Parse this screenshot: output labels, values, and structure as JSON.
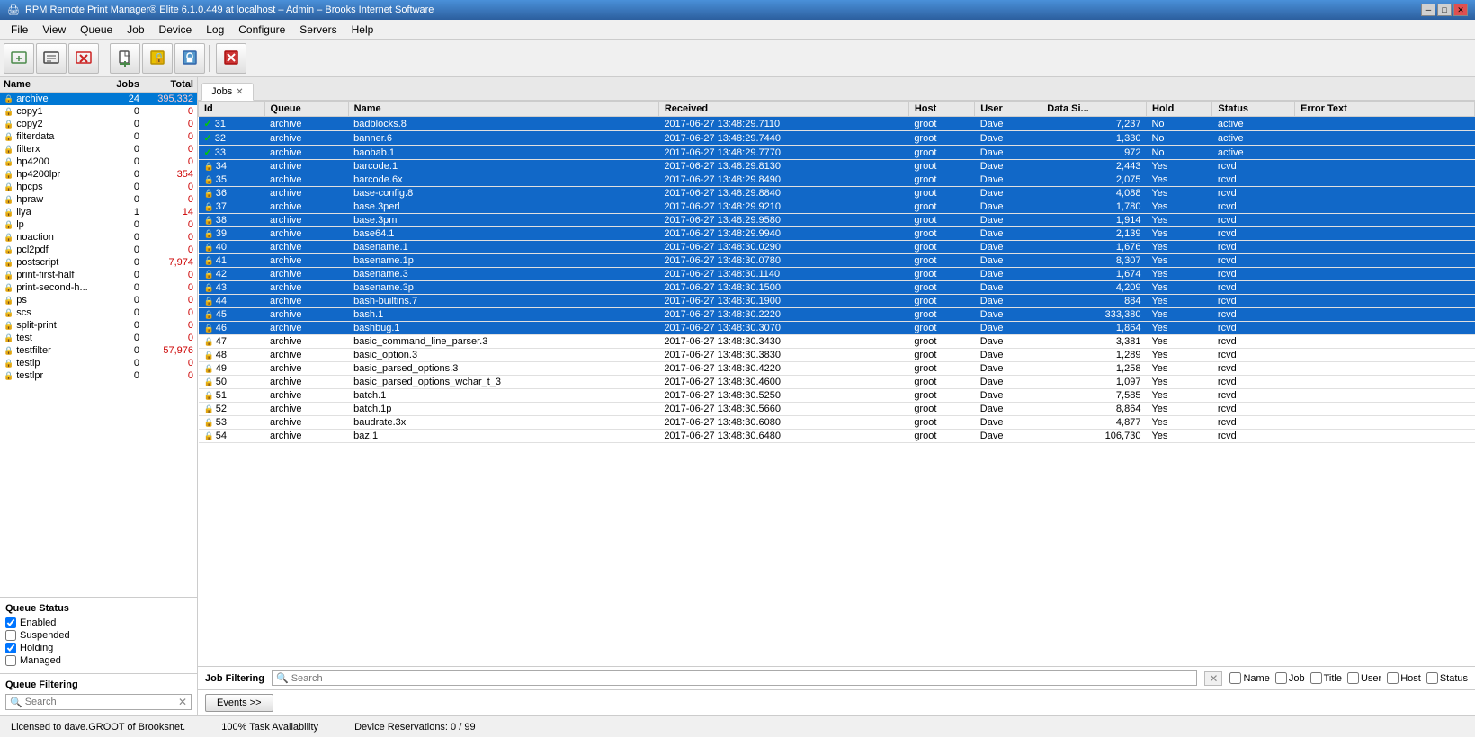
{
  "titlebar": {
    "title": "RPM Remote Print Manager® Elite  6.1.0.449  at localhost – Admin – Brooks Internet Software",
    "icon": "🖨"
  },
  "menubar": {
    "items": [
      "File",
      "View",
      "Queue",
      "Job",
      "Device",
      "Log",
      "Configure",
      "Servers",
      "Help"
    ]
  },
  "toolbar": {
    "buttons": [
      {
        "name": "add-queue",
        "icon": "➕",
        "label": "Add Queue"
      },
      {
        "name": "edit-queue",
        "icon": "✏",
        "label": "Edit Queue"
      },
      {
        "name": "delete-queue",
        "icon": "🗑",
        "label": "Delete Queue"
      },
      {
        "name": "sep1",
        "type": "separator"
      },
      {
        "name": "new-job",
        "icon": "📄",
        "label": "New Job"
      },
      {
        "name": "hold-job",
        "icon": "🔒",
        "label": "Hold Job"
      },
      {
        "name": "lock-queue",
        "icon": "🔐",
        "label": "Lock Queue"
      },
      {
        "name": "sep2",
        "type": "separator"
      },
      {
        "name": "delete-job",
        "icon": "❌",
        "label": "Delete Job"
      }
    ]
  },
  "left_panel": {
    "column_headers": [
      "Name",
      "Jobs",
      "Total"
    ],
    "queues": [
      {
        "name": "archive",
        "jobs": 24,
        "total": "395,332",
        "icon": "lock",
        "selected": true
      },
      {
        "name": "copy1",
        "jobs": 0,
        "total": "0",
        "icon": "lock"
      },
      {
        "name": "copy2",
        "jobs": 0,
        "total": "0",
        "icon": "lock"
      },
      {
        "name": "filterdata",
        "jobs": 0,
        "total": "0",
        "icon": "lock"
      },
      {
        "name": "filterx",
        "jobs": 0,
        "total": "0",
        "icon": "lock"
      },
      {
        "name": "hp4200",
        "jobs": 0,
        "total": "0",
        "icon": "lock"
      },
      {
        "name": "hp4200lpr",
        "jobs": 0,
        "total": "354",
        "icon": "lock"
      },
      {
        "name": "hpcps",
        "jobs": 0,
        "total": "0",
        "icon": "lock"
      },
      {
        "name": "hpraw",
        "jobs": 0,
        "total": "0",
        "icon": "lock"
      },
      {
        "name": "ilya",
        "jobs": 1,
        "total": "14",
        "icon": "lock"
      },
      {
        "name": "lp",
        "jobs": 0,
        "total": "0",
        "icon": "lock"
      },
      {
        "name": "noaction",
        "jobs": 0,
        "total": "0",
        "icon": "lock"
      },
      {
        "name": "pcl2pdf",
        "jobs": 0,
        "total": "0",
        "icon": "lock"
      },
      {
        "name": "postscript",
        "jobs": 0,
        "total": "7,974",
        "icon": "lock"
      },
      {
        "name": "print-first-half",
        "jobs": 0,
        "total": "0",
        "icon": "lock"
      },
      {
        "name": "print-second-h...",
        "jobs": 0,
        "total": "0",
        "icon": "lock"
      },
      {
        "name": "ps",
        "jobs": 0,
        "total": "0",
        "icon": "lock"
      },
      {
        "name": "scs",
        "jobs": 0,
        "total": "0",
        "icon": "lock"
      },
      {
        "name": "split-print",
        "jobs": 0,
        "total": "0",
        "icon": "lock"
      },
      {
        "name": "test",
        "jobs": 0,
        "total": "0",
        "icon": "lock"
      },
      {
        "name": "testfilter",
        "jobs": 0,
        "total": "57,976",
        "icon": "lock"
      },
      {
        "name": "testip",
        "jobs": 0,
        "total": "0",
        "icon": "lock"
      },
      {
        "name": "testlpr",
        "jobs": 0,
        "total": "0",
        "icon": "lock"
      }
    ],
    "queue_status": {
      "title": "Queue Status",
      "items": [
        {
          "label": "Enabled",
          "checked": true
        },
        {
          "label": "Suspended",
          "checked": false
        },
        {
          "label": "Holding",
          "checked": true
        },
        {
          "label": "Managed",
          "checked": false
        }
      ]
    },
    "queue_filtering": {
      "title": "Queue Filtering",
      "search_placeholder": "Search"
    }
  },
  "main_panel": {
    "tab": {
      "label": "Jobs",
      "closeable": true
    },
    "table": {
      "columns": [
        "Id",
        "Queue",
        "Name",
        "Received",
        "Host",
        "User",
        "Data Si...",
        "Hold",
        "Status",
        "Error Text"
      ],
      "rows": [
        {
          "id": 31,
          "queue": "archive",
          "name": "badblocks.8",
          "received": "2017-06-27 13:48:29.7110",
          "host": "groot",
          "user": "Dave",
          "data_size": "7,237",
          "hold": "No",
          "status": "active",
          "error": "",
          "highlighted": true,
          "check": true
        },
        {
          "id": 32,
          "queue": "archive",
          "name": "banner.6",
          "received": "2017-06-27 13:48:29.7440",
          "host": "groot",
          "user": "Dave",
          "data_size": "1,330",
          "hold": "No",
          "status": "active",
          "error": "",
          "highlighted": true,
          "check": true
        },
        {
          "id": 33,
          "queue": "archive",
          "name": "baobab.1",
          "received": "2017-06-27 13:48:29.7770",
          "host": "groot",
          "user": "Dave",
          "data_size": "972",
          "hold": "No",
          "status": "active",
          "error": "",
          "highlighted": true,
          "check": true
        },
        {
          "id": 34,
          "queue": "archive",
          "name": "barcode.1",
          "received": "2017-06-27 13:48:29.8130",
          "host": "groot",
          "user": "Dave",
          "data_size": "2,443",
          "hold": "Yes",
          "status": "rcvd",
          "error": "",
          "highlighted": true
        },
        {
          "id": 35,
          "queue": "archive",
          "name": "barcode.6x",
          "received": "2017-06-27 13:48:29.8490",
          "host": "groot",
          "user": "Dave",
          "data_size": "2,075",
          "hold": "Yes",
          "status": "rcvd",
          "error": "",
          "highlighted": true
        },
        {
          "id": 36,
          "queue": "archive",
          "name": "base-config.8",
          "received": "2017-06-27 13:48:29.8840",
          "host": "groot",
          "user": "Dave",
          "data_size": "4,088",
          "hold": "Yes",
          "status": "rcvd",
          "error": "",
          "highlighted": true
        },
        {
          "id": 37,
          "queue": "archive",
          "name": "base.3perl",
          "received": "2017-06-27 13:48:29.9210",
          "host": "groot",
          "user": "Dave",
          "data_size": "1,780",
          "hold": "Yes",
          "status": "rcvd",
          "error": "",
          "highlighted": true
        },
        {
          "id": 38,
          "queue": "archive",
          "name": "base.3pm",
          "received": "2017-06-27 13:48:29.9580",
          "host": "groot",
          "user": "Dave",
          "data_size": "1,914",
          "hold": "Yes",
          "status": "rcvd",
          "error": "",
          "highlighted": true
        },
        {
          "id": 39,
          "queue": "archive",
          "name": "base64.1",
          "received": "2017-06-27 13:48:29.9940",
          "host": "groot",
          "user": "Dave",
          "data_size": "2,139",
          "hold": "Yes",
          "status": "rcvd",
          "error": "",
          "highlighted": true
        },
        {
          "id": 40,
          "queue": "archive",
          "name": "basename.1",
          "received": "2017-06-27 13:48:30.0290",
          "host": "groot",
          "user": "Dave",
          "data_size": "1,676",
          "hold": "Yes",
          "status": "rcvd",
          "error": "",
          "highlighted": true
        },
        {
          "id": 41,
          "queue": "archive",
          "name": "basename.1p",
          "received": "2017-06-27 13:48:30.0780",
          "host": "groot",
          "user": "Dave",
          "data_size": "8,307",
          "hold": "Yes",
          "status": "rcvd",
          "error": "",
          "highlighted": true
        },
        {
          "id": 42,
          "queue": "archive",
          "name": "basename.3",
          "received": "2017-06-27 13:48:30.1140",
          "host": "groot",
          "user": "Dave",
          "data_size": "1,674",
          "hold": "Yes",
          "status": "rcvd",
          "error": "",
          "highlighted": true
        },
        {
          "id": 43,
          "queue": "archive",
          "name": "basename.3p",
          "received": "2017-06-27 13:48:30.1500",
          "host": "groot",
          "user": "Dave",
          "data_size": "4,209",
          "hold": "Yes",
          "status": "rcvd",
          "error": "",
          "highlighted": true
        },
        {
          "id": 44,
          "queue": "archive",
          "name": "bash-builtins.7",
          "received": "2017-06-27 13:48:30.1900",
          "host": "groot",
          "user": "Dave",
          "data_size": "884",
          "hold": "Yes",
          "status": "rcvd",
          "error": "",
          "highlighted": true
        },
        {
          "id": 45,
          "queue": "archive",
          "name": "bash.1",
          "received": "2017-06-27 13:48:30.2220",
          "host": "groot",
          "user": "Dave",
          "data_size": "333,380",
          "hold": "Yes",
          "status": "rcvd",
          "error": "",
          "highlighted": true
        },
        {
          "id": 46,
          "queue": "archive",
          "name": "bashbug.1",
          "received": "2017-06-27 13:48:30.3070",
          "host": "groot",
          "user": "Dave",
          "data_size": "1,864",
          "hold": "Yes",
          "status": "rcvd",
          "error": "",
          "highlighted": true
        },
        {
          "id": 47,
          "queue": "archive",
          "name": "basic_command_line_parser.3",
          "received": "2017-06-27 13:48:30.3430",
          "host": "groot",
          "user": "Dave",
          "data_size": "3,381",
          "hold": "Yes",
          "status": "rcvd",
          "error": "",
          "highlighted": false
        },
        {
          "id": 48,
          "queue": "archive",
          "name": "basic_option.3",
          "received": "2017-06-27 13:48:30.3830",
          "host": "groot",
          "user": "Dave",
          "data_size": "1,289",
          "hold": "Yes",
          "status": "rcvd",
          "error": "",
          "highlighted": false
        },
        {
          "id": 49,
          "queue": "archive",
          "name": "basic_parsed_options.3",
          "received": "2017-06-27 13:48:30.4220",
          "host": "groot",
          "user": "Dave",
          "data_size": "1,258",
          "hold": "Yes",
          "status": "rcvd",
          "error": "",
          "highlighted": false
        },
        {
          "id": 50,
          "queue": "archive",
          "name": "basic_parsed_options_wchar_t_3",
          "received": "2017-06-27 13:48:30.4600",
          "host": "groot",
          "user": "Dave",
          "data_size": "1,097",
          "hold": "Yes",
          "status": "rcvd",
          "error": "",
          "highlighted": false
        },
        {
          "id": 51,
          "queue": "archive",
          "name": "batch.1",
          "received": "2017-06-27 13:48:30.5250",
          "host": "groot",
          "user": "Dave",
          "data_size": "7,585",
          "hold": "Yes",
          "status": "rcvd",
          "error": "",
          "highlighted": false
        },
        {
          "id": 52,
          "queue": "archive",
          "name": "batch.1p",
          "received": "2017-06-27 13:48:30.5660",
          "host": "groot",
          "user": "Dave",
          "data_size": "8,864",
          "hold": "Yes",
          "status": "rcvd",
          "error": "",
          "highlighted": false
        },
        {
          "id": 53,
          "queue": "archive",
          "name": "baudrate.3x",
          "received": "2017-06-27 13:48:30.6080",
          "host": "groot",
          "user": "Dave",
          "data_size": "4,877",
          "hold": "Yes",
          "status": "rcvd",
          "error": "",
          "highlighted": false
        },
        {
          "id": 54,
          "queue": "archive",
          "name": "baz.1",
          "received": "2017-06-27 13:48:30.6480",
          "host": "groot",
          "user": "Dave",
          "data_size": "106,730",
          "hold": "Yes",
          "status": "rcvd",
          "error": "",
          "highlighted": false
        }
      ]
    },
    "job_filtering": {
      "title": "Job Filtering",
      "search_placeholder": "Search",
      "filters": [
        "Name",
        "Job",
        "Title",
        "User",
        "Host",
        "Status"
      ]
    },
    "events_button": "Events >>"
  },
  "statusbar": {
    "license": "Licensed to dave.GROOT of Brooksnet.",
    "availability": "100% Task Availability",
    "reservations": "Device Reservations: 0 / 99"
  }
}
